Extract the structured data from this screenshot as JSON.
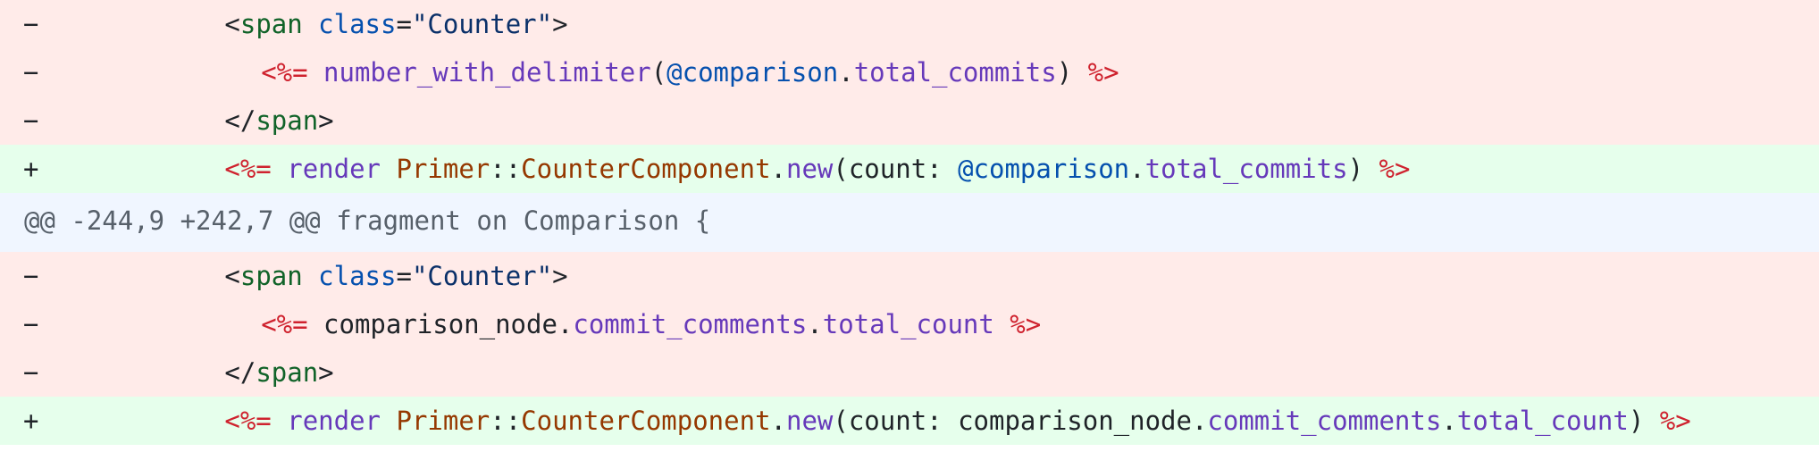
{
  "diff": {
    "lines": [
      {
        "type": "del",
        "marker": "−",
        "indent": 11,
        "tokens": [
          {
            "text": "<",
            "cls": "plain"
          },
          {
            "text": "span",
            "cls": "tag"
          },
          {
            "text": " ",
            "cls": "plain"
          },
          {
            "text": "class",
            "cls": "attr"
          },
          {
            "text": "=",
            "cls": "plain"
          },
          {
            "text": "\"Counter\"",
            "cls": "str"
          },
          {
            "text": ">",
            "cls": "plain"
          }
        ]
      },
      {
        "type": "del",
        "marker": "−",
        "indent": 13,
        "tokens": [
          {
            "text": "<%=",
            "cls": "erb"
          },
          {
            "text": " ",
            "cls": "plain"
          },
          {
            "text": "number_with_delimiter",
            "cls": "fn"
          },
          {
            "text": "(",
            "cls": "plain"
          },
          {
            "text": "@comparison",
            "cls": "ivar"
          },
          {
            "text": ".",
            "cls": "plain"
          },
          {
            "text": "total_commits",
            "cls": "fn"
          },
          {
            "text": ") ",
            "cls": "plain"
          },
          {
            "text": "%>",
            "cls": "erb"
          }
        ]
      },
      {
        "type": "del",
        "marker": "−",
        "indent": 11,
        "tokens": [
          {
            "text": "</",
            "cls": "plain"
          },
          {
            "text": "span",
            "cls": "tag"
          },
          {
            "text": ">",
            "cls": "plain"
          }
        ]
      },
      {
        "type": "add",
        "marker": "+",
        "indent": 11,
        "tokens": [
          {
            "text": "<%=",
            "cls": "erb"
          },
          {
            "text": " ",
            "cls": "plain"
          },
          {
            "text": "render",
            "cls": "fn"
          },
          {
            "text": " ",
            "cls": "plain"
          },
          {
            "text": "Primer",
            "cls": "const"
          },
          {
            "text": "::",
            "cls": "plain"
          },
          {
            "text": "CounterComponent",
            "cls": "const"
          },
          {
            "text": ".",
            "cls": "plain"
          },
          {
            "text": "new",
            "cls": "fn"
          },
          {
            "text": "(count: ",
            "cls": "plain"
          },
          {
            "text": "@comparison",
            "cls": "ivar"
          },
          {
            "text": ".",
            "cls": "plain"
          },
          {
            "text": "total_commits",
            "cls": "fn"
          },
          {
            "text": ") ",
            "cls": "plain"
          },
          {
            "text": "%>",
            "cls": "erb"
          }
        ]
      },
      {
        "type": "hunk",
        "marker": "",
        "indent": 0,
        "tokens": [
          {
            "text": "@@ -244,9 +242,7 @@ fragment on Comparison {",
            "cls": "hunk"
          }
        ]
      },
      {
        "type": "del",
        "marker": "−",
        "indent": 11,
        "tokens": [
          {
            "text": "<",
            "cls": "plain"
          },
          {
            "text": "span",
            "cls": "tag"
          },
          {
            "text": " ",
            "cls": "plain"
          },
          {
            "text": "class",
            "cls": "attr"
          },
          {
            "text": "=",
            "cls": "plain"
          },
          {
            "text": "\"Counter\"",
            "cls": "str"
          },
          {
            "text": ">",
            "cls": "plain"
          }
        ]
      },
      {
        "type": "del",
        "marker": "−",
        "indent": 13,
        "tokens": [
          {
            "text": "<%=",
            "cls": "erb"
          },
          {
            "text": " comparison_node.",
            "cls": "plain"
          },
          {
            "text": "commit_comments",
            "cls": "fn"
          },
          {
            "text": ".",
            "cls": "plain"
          },
          {
            "text": "total_count",
            "cls": "fn"
          },
          {
            "text": " ",
            "cls": "plain"
          },
          {
            "text": "%>",
            "cls": "erb"
          }
        ]
      },
      {
        "type": "del",
        "marker": "−",
        "indent": 11,
        "tokens": [
          {
            "text": "</",
            "cls": "plain"
          },
          {
            "text": "span",
            "cls": "tag"
          },
          {
            "text": ">",
            "cls": "plain"
          }
        ]
      },
      {
        "type": "add",
        "marker": "+",
        "indent": 11,
        "tokens": [
          {
            "text": "<%=",
            "cls": "erb"
          },
          {
            "text": " ",
            "cls": "plain"
          },
          {
            "text": "render",
            "cls": "fn"
          },
          {
            "text": " ",
            "cls": "plain"
          },
          {
            "text": "Primer",
            "cls": "const"
          },
          {
            "text": "::",
            "cls": "plain"
          },
          {
            "text": "CounterComponent",
            "cls": "const"
          },
          {
            "text": ".",
            "cls": "plain"
          },
          {
            "text": "new",
            "cls": "fn"
          },
          {
            "text": "(count: comparison_node.",
            "cls": "plain"
          },
          {
            "text": "commit_comments",
            "cls": "fn"
          },
          {
            "text": ".",
            "cls": "plain"
          },
          {
            "text": "total_count",
            "cls": "fn"
          },
          {
            "text": ") ",
            "cls": "plain"
          },
          {
            "text": "%>",
            "cls": "erb"
          }
        ]
      }
    ]
  },
  "colors": {
    "deletion_bg": "#ffebe9",
    "addition_bg": "#e6ffec",
    "hunk_bg": "#f0f6ff"
  }
}
